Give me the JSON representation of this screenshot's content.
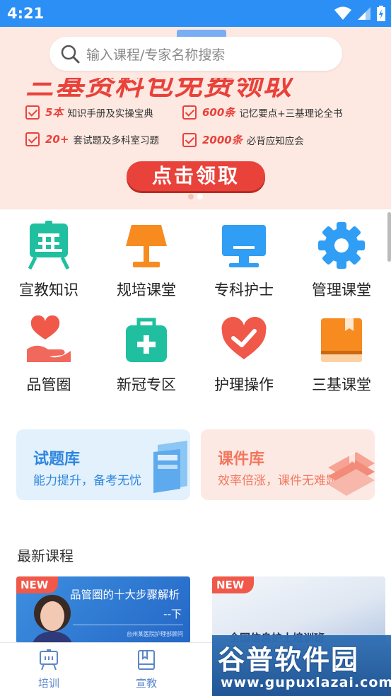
{
  "status_bar": {
    "time": "4:21"
  },
  "search": {
    "placeholder": "输入课程/专家名称搜索"
  },
  "banner": {
    "headline": "三基资料包免费领取",
    "features": [
      {
        "num": "5本",
        "text": "知识手册及实操宝典"
      },
      {
        "num": "600条",
        "text": "记忆要点+三基理论全书"
      },
      {
        "num": "20+",
        "text": "套试题及多科室习题"
      },
      {
        "num": "2000条",
        "text": "必背应知应会"
      }
    ],
    "cta": "点击领取",
    "page_index": 2,
    "page_count": 2
  },
  "grid": {
    "items": [
      {
        "label": "宣教知识",
        "icon": "easel-icon",
        "color": "#1fbf9f"
      },
      {
        "label": "规培课堂",
        "icon": "lamp-icon",
        "color": "#f78b1f"
      },
      {
        "label": "专科护士",
        "icon": "monitor-icon",
        "color": "#2f9ef4"
      },
      {
        "label": "管理课堂",
        "icon": "gear-icon",
        "color": "#2f9ef4"
      },
      {
        "label": "品管圈",
        "icon": "heart-hand-icon",
        "color": "#f0584a"
      },
      {
        "label": "新冠专区",
        "icon": "medical-kit-icon",
        "color": "#1fbf9f"
      },
      {
        "label": "护理操作",
        "icon": "heart-check-icon",
        "color": "#f0584a"
      },
      {
        "label": "三基课堂",
        "icon": "book-icon",
        "color": "#f78b1f"
      }
    ]
  },
  "cards": [
    {
      "title": "试题库",
      "subtitle": "能力提升，备考无忧",
      "icon": "stacked-papers-icon"
    },
    {
      "title": "课件库",
      "subtitle": "效率倍涨，课件无难题",
      "icon": "book-stack-icon"
    }
  ],
  "section": {
    "title": "最新课程"
  },
  "courses": [
    {
      "tag": "NEW",
      "title": "品管圈的十大步骤解析",
      "subtitle": "--下",
      "footer": "台州某医院护理部顾问"
    },
    {
      "tag": "NEW",
      "title": "全国信息护士培训班"
    }
  ],
  "tabbar": {
    "tabs": [
      {
        "label": "培训",
        "icon": "easel-outline-icon"
      },
      {
        "label": "宣教",
        "icon": "book-outline-icon"
      }
    ]
  },
  "watermark": {
    "brand": "谷普软件园",
    "url": "www.gupuxlazai.com"
  }
}
